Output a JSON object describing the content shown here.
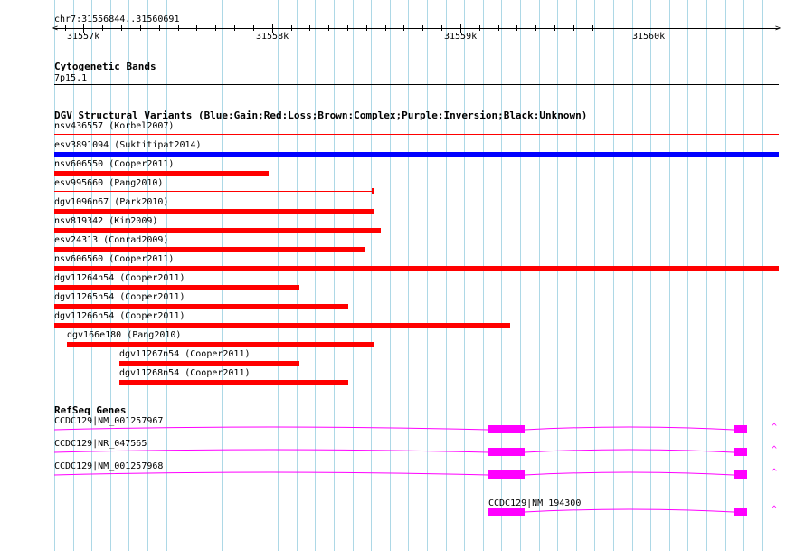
{
  "colors": {
    "grid": "#add8e6",
    "gain": "#0000ff",
    "loss": "#ff0000",
    "gene": "#ff00ff"
  },
  "ruler": {
    "location": "chr7:31556844..31560691",
    "ticks": [
      "31557k",
      "31558k",
      "31559k",
      "31560k"
    ]
  },
  "cytobands": {
    "title": "Cytogenetic Bands",
    "band": "7p15.1"
  },
  "dgv": {
    "title": "DGV Structural Variants (Blue:Gain;Red:Loss;Brown:Complex;Purple:Inversion;Black:Unknown)",
    "variants": [
      {
        "label": "nsv436557 (Korbel2007)",
        "type": "loss",
        "start": 31556844,
        "end": 31560691
      },
      {
        "label": "esv3891094 (Suktitipat2014)",
        "type": "gain",
        "start": 31556844,
        "end": 31560691
      },
      {
        "label": "nsv606550 (Cooper2011)",
        "type": "loss",
        "start": 31556844,
        "end": 31557980
      },
      {
        "label": "esv995660 (Pang2010)",
        "type": "loss",
        "start": 31556844,
        "end": 31558530
      },
      {
        "label": "dgv1096n67 (Park2010)",
        "type": "loss",
        "start": 31556844,
        "end": 31558540
      },
      {
        "label": "nsv819342 (Kim2009)",
        "type": "loss",
        "start": 31556844,
        "end": 31558580
      },
      {
        "label": "esv24313 (Conrad2009)",
        "type": "loss",
        "start": 31556844,
        "end": 31558490
      },
      {
        "label": "nsv606560 (Cooper2011)",
        "type": "loss",
        "start": 31556844,
        "end": 31560691
      },
      {
        "label": "dgv11264n54 (Cooper2011)",
        "type": "loss",
        "start": 31556844,
        "end": 31558145
      },
      {
        "label": "dgv11265n54 (Cooper2011)",
        "type": "loss",
        "start": 31556844,
        "end": 31558405
      },
      {
        "label": "dgv11266n54 (Cooper2011)",
        "type": "loss",
        "start": 31556844,
        "end": 31559265
      },
      {
        "label": "dgv166e180 (Pang2010)",
        "type": "loss",
        "start": 31556910,
        "end": 31558540
      },
      {
        "label": "dgv11267n54 (Cooper2011)",
        "type": "loss",
        "start": 31557190,
        "end": 31558145
      },
      {
        "label": "dgv11268n54 (Cooper2011)",
        "type": "loss",
        "start": 31557190,
        "end": 31558405
      }
    ]
  },
  "refseq": {
    "title": "RefSeq Genes",
    "genes": [
      {
        "label": "CCDC129|NM_001257967",
        "start": 31556844,
        "end": 31560691,
        "exons": [
          [
            31559150,
            31559340
          ],
          [
            31560450,
            31560520
          ]
        ]
      },
      {
        "label": "CCDC129|NR_047565",
        "start": 31556844,
        "end": 31560691,
        "exons": [
          [
            31559150,
            31559340
          ],
          [
            31560450,
            31560520
          ]
        ]
      },
      {
        "label": "CCDC129|NM_001257968",
        "start": 31556844,
        "end": 31560691,
        "exons": [
          [
            31559150,
            31559340
          ],
          [
            31560450,
            31560520
          ]
        ]
      },
      {
        "label": "CCDC129|NM_194300",
        "start": 31559150,
        "end": 31560691,
        "exons": [
          [
            31559150,
            31559340
          ],
          [
            31560450,
            31560520
          ]
        ]
      }
    ]
  }
}
